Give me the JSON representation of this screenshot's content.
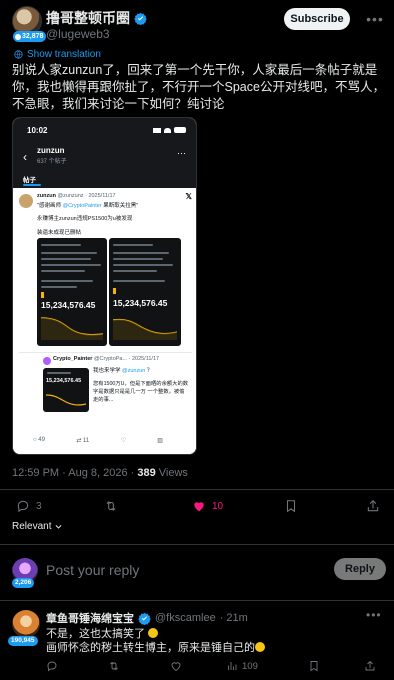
{
  "post": {
    "author_name": "撸哥整顿币圈",
    "author_handle": "@lugeweb3",
    "author_badge_count": "32,878",
    "subscribe_label": "Subscribe",
    "show_translation": "Show translation",
    "text": "别说人家zunzun了，回来了第一个先干你，人家最后一条帖子就是你，我也懒得再跟你扯了，不行开一个Space公开对线吧，不骂人，不急眼，我们来讨论一下如何？纯讨论",
    "time": "12:59 PM · Aug 8, 2026 · ",
    "views_count": "389",
    "views_label": "Views",
    "actions": {
      "replies": "3",
      "reposts": "",
      "likes": "10",
      "bookmarks": "",
      "share": ""
    },
    "sort_label": "Relevant"
  },
  "media": {
    "status_time": "10:02",
    "community_name": "zunzun",
    "community_sub": "637 个帖子",
    "tab_label": "帖子",
    "tweet_author": "zunzun",
    "tweet_handle": "@zunzunz · 2025/11/17",
    "tweet_quote_a": "\"感谢画师 ",
    "tweet_quote_mention": "@CryptoPainter",
    "tweet_quote_b": " 果断取关拉黑\"",
    "tweet_line1": "永赚博主zunzun违规PS1500为u被发现",
    "tweet_line2": "装逼未成现已删帖",
    "shot_number_left": "15,234,576.45",
    "shot_number_right": "15,234,576.45",
    "quoted_name": "Crypto_Painter",
    "quoted_handle": "@CryptoPa... · 2025/11/17",
    "quoted_text1": "我也来学学 ",
    "quoted_text1_mention": "@zunzun",
    "quoted_text1_end": " ？",
    "quoted_text2": "您有1500万U，但是下面晒的余额大的数字是数据只是是几一万 一个整数，被偷走的事...",
    "quoted_shot_number": "15,234,576.45",
    "actions": {
      "replies": "49",
      "reposts": "11",
      "likes": "",
      "views": ""
    }
  },
  "reply_box": {
    "avatar_badge": "2,206",
    "placeholder": "Post your reply",
    "button": "Reply"
  },
  "comment": {
    "author_name": "章鱼哥锤海绵宝宝",
    "author_handle": "@fkscamlee",
    "time": "· 21m",
    "badge": "190,945",
    "line1": "不是，这也太搞笑了",
    "line2": "画师怀念的秽土转生博主，原来是锤自己的",
    "actions": {
      "replies": "",
      "reposts": "",
      "likes": "",
      "views": "109",
      "bookmarks": "",
      "share": ""
    }
  },
  "colors": {
    "accent": "#1d9bf0",
    "like": "#f91880",
    "background": "#000000",
    "text": "#e7e9ea",
    "muted": "#71767b"
  },
  "icons": [
    "verified-badge-icon",
    "more-icon",
    "translate-icon",
    "reply-icon",
    "repost-icon",
    "heart-icon",
    "bookmark-icon",
    "share-icon",
    "views-icon",
    "chevron-down-icon"
  ]
}
